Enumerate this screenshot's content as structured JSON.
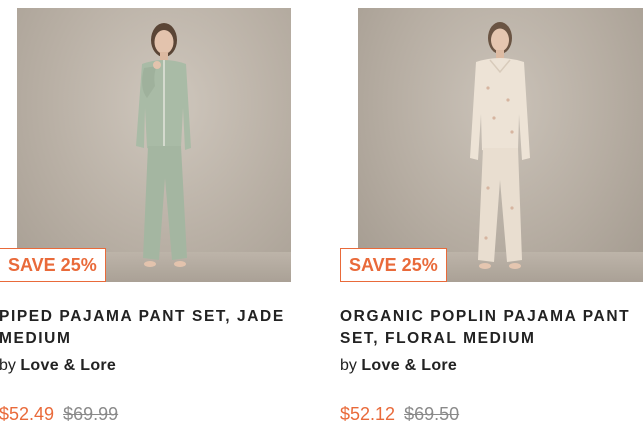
{
  "products": [
    {
      "badge": "SAVE 25%",
      "title_line1": "PIPED PAJAMA PANT SET, JADE",
      "title_line2": "MEDIUM",
      "by": "by",
      "brand": "Love & Lore",
      "sale_price": "$52.49",
      "original_price": "$69.99"
    },
    {
      "badge": "SAVE 25%",
      "title_line1": "ORGANIC POPLIN PAJAMA PANT",
      "title_line2": "SET, FLORAL MEDIUM",
      "by": "by",
      "brand": "Love & Lore",
      "sale_price": "$52.12",
      "original_price": "$69.50"
    }
  ],
  "colors": {
    "accent": "#e96a3a",
    "text": "#222222",
    "strike": "#8a8a8a",
    "jade_pajama": "#a9bba6",
    "floral_pajama": "#ede3d6"
  }
}
